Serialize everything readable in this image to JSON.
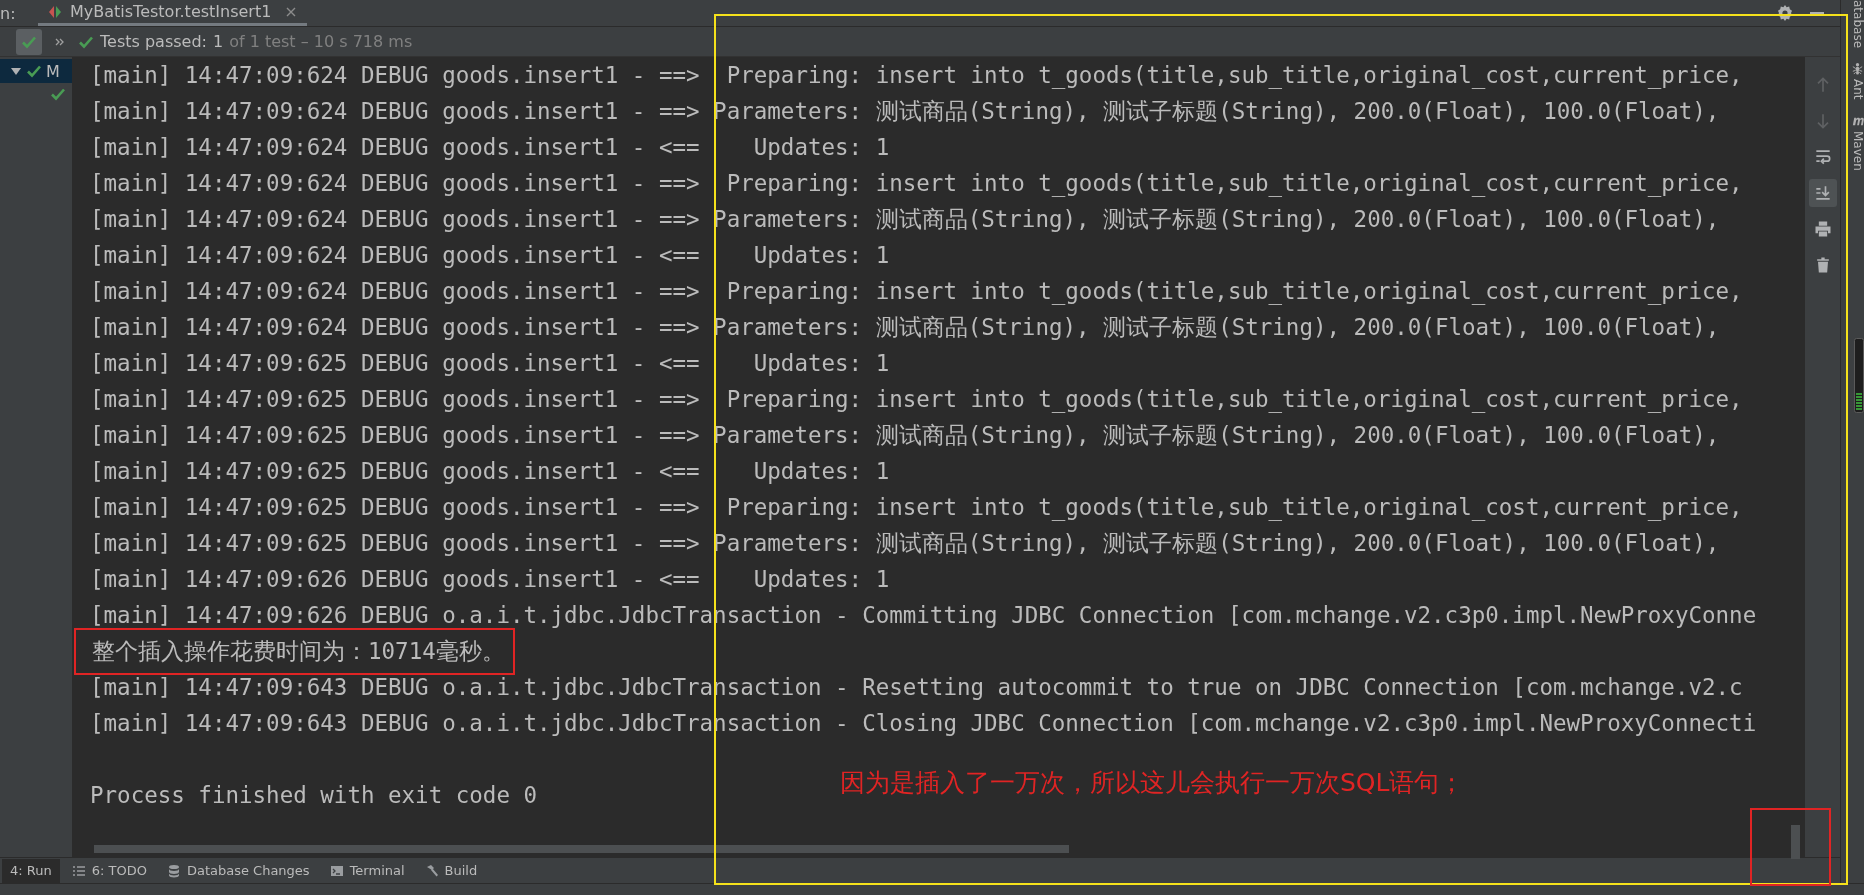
{
  "run_tab": {
    "prefix": "n:",
    "title": "MyBatisTestor.testInsert1"
  },
  "toolbar": {
    "status": "Tests passed:",
    "count": "1",
    "detail": "of 1 test – 10 s 718 ms"
  },
  "tree": {
    "label": "M",
    "expanded": true,
    "selected": true,
    "children": [
      {
        "kind": "test"
      }
    ]
  },
  "console": {
    "lines": [
      {
        "text": "[main] 14:47:09:624 DEBUG goods.insert1 - ==>  Preparing: insert into t_goods(title,sub_title,original_cost,current_price,",
        "annotated": false
      },
      {
        "text": "[main] 14:47:09:624 DEBUG goods.insert1 - ==> Parameters: 测试商品(String), 测试子标题(String), 200.0(Float), 100.0(Float),",
        "annotated": false
      },
      {
        "text": "[main] 14:47:09:624 DEBUG goods.insert1 - <==    Updates: 1",
        "annotated": false
      },
      {
        "text": "[main] 14:47:09:624 DEBUG goods.insert1 - ==>  Preparing: insert into t_goods(title,sub_title,original_cost,current_price,",
        "annotated": false
      },
      {
        "text": "[main] 14:47:09:624 DEBUG goods.insert1 - ==> Parameters: 测试商品(String), 测试子标题(String), 200.0(Float), 100.0(Float),",
        "annotated": false
      },
      {
        "text": "[main] 14:47:09:624 DEBUG goods.insert1 - <==    Updates: 1",
        "annotated": false
      },
      {
        "text": "[main] 14:47:09:624 DEBUG goods.insert1 - ==>  Preparing: insert into t_goods(title,sub_title,original_cost,current_price,",
        "annotated": false
      },
      {
        "text": "[main] 14:47:09:624 DEBUG goods.insert1 - ==> Parameters: 测试商品(String), 测试子标题(String), 200.0(Float), 100.0(Float),",
        "annotated": false
      },
      {
        "text": "[main] 14:47:09:625 DEBUG goods.insert1 - <==    Updates: 1",
        "annotated": false
      },
      {
        "text": "[main] 14:47:09:625 DEBUG goods.insert1 - ==>  Preparing: insert into t_goods(title,sub_title,original_cost,current_price,",
        "annotated": false
      },
      {
        "text": "[main] 14:47:09:625 DEBUG goods.insert1 - ==> Parameters: 测试商品(String), 测试子标题(String), 200.0(Float), 100.0(Float),",
        "annotated": false
      },
      {
        "text": "[main] 14:47:09:625 DEBUG goods.insert1 - <==    Updates: 1",
        "annotated": false
      },
      {
        "text": "[main] 14:47:09:625 DEBUG goods.insert1 - ==>  Preparing: insert into t_goods(title,sub_title,original_cost,current_price,",
        "annotated": false
      },
      {
        "text": "[main] 14:47:09:625 DEBUG goods.insert1 - ==> Parameters: 测试商品(String), 测试子标题(String), 200.0(Float), 100.0(Float),",
        "annotated": false
      },
      {
        "text": "[main] 14:47:09:626 DEBUG goods.insert1 - <==    Updates: 1",
        "annotated": false
      },
      {
        "text": "[main] 14:47:09:626 DEBUG o.a.i.t.jdbc.JdbcTransaction - Committing JDBC Connection [com.mchange.v2.c3p0.impl.NewProxyConne",
        "annotated": false
      },
      {
        "text": "整个插入操作花费时间为：10714毫秒。",
        "annotated": true
      },
      {
        "text": "[main] 14:47:09:643 DEBUG o.a.i.t.jdbc.JdbcTransaction - Resetting autocommit to true on JDBC Connection [com.mchange.v2.c",
        "annotated": false
      },
      {
        "text": "[main] 14:47:09:643 DEBUG o.a.i.t.jdbc.JdbcTransaction - Closing JDBC Connection [com.mchange.v2.c3p0.impl.NewProxyConnecti",
        "annotated": false
      },
      {
        "text": "Process finished with exit code 0",
        "annotated": false
      }
    ]
  },
  "annotation": {
    "note": "因为是插入了一万次，所以这儿会执行一万次SQL语句；"
  },
  "console_tools": [
    {
      "kind": "up",
      "disabled": true,
      "on": false
    },
    {
      "kind": "down",
      "disabled": true,
      "on": false
    },
    {
      "kind": "wrap",
      "disabled": false,
      "on": false
    },
    {
      "kind": "scroll-end",
      "disabled": false,
      "on": true
    },
    {
      "kind": "print",
      "disabled": false,
      "on": false
    },
    {
      "kind": "trash",
      "disabled": false,
      "on": false
    }
  ],
  "side_tools": [
    {
      "kind": "database",
      "label": "atabase"
    },
    {
      "kind": "ant",
      "label": "Ant"
    },
    {
      "kind": "maven",
      "label": "Maven"
    }
  ],
  "bottom_tabs": [
    {
      "kind": "run",
      "label": "4: Run",
      "selected": true
    },
    {
      "kind": "todo",
      "label": "6: TODO",
      "selected": false
    },
    {
      "kind": "database",
      "label": "Database Changes",
      "selected": false
    },
    {
      "kind": "terminal",
      "label": "Terminal",
      "selected": false
    },
    {
      "kind": "build",
      "label": "Build",
      "selected": false
    }
  ]
}
